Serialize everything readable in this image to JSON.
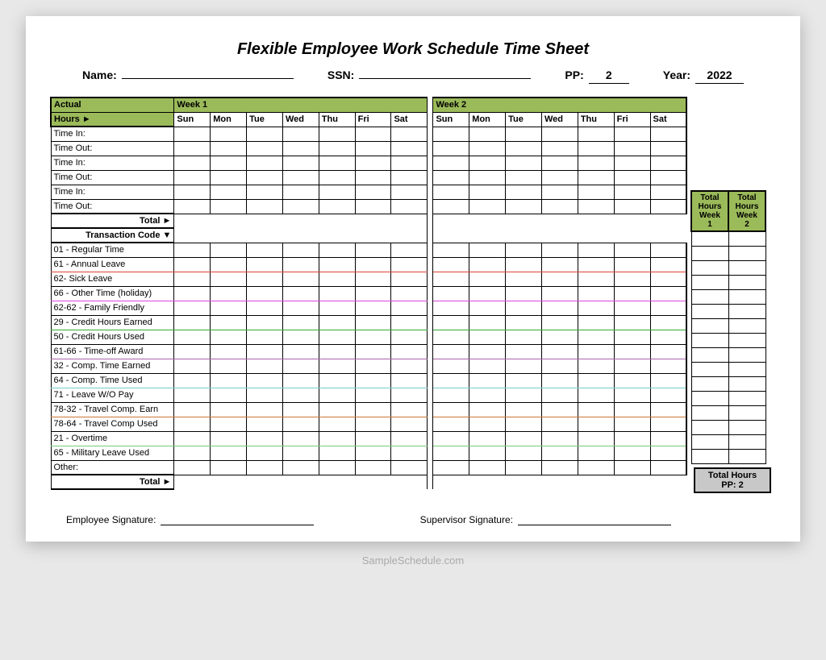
{
  "title": "Flexible Employee Work Schedule Time Sheet",
  "meta": {
    "name_label": "Name:",
    "name_value": "",
    "ssn_label": "SSN:",
    "ssn_value": "",
    "pp_label": "PP:",
    "pp_value": "2",
    "year_label": "Year:",
    "year_value": "2022"
  },
  "headers": {
    "actual_line1": "Actual",
    "actual_line2": "Hours ►",
    "week1": "Week 1",
    "week2": "Week 2",
    "days": [
      "Sun",
      "Mon",
      "Tue",
      "Wed",
      "Thu",
      "Fri",
      "Sat"
    ]
  },
  "time_rows": [
    "Time In:",
    "Time Out:",
    "Time In:",
    "Time Out:",
    "Time In:",
    "Time Out:"
  ],
  "total_label": "Total ►",
  "trans_header": "Transaction Code ▼",
  "trans_rows": [
    {
      "label": "01 - Regular Time",
      "cls": ""
    },
    {
      "label": "61 - Annual Leave",
      "cls": "u-red"
    },
    {
      "label": "62- Sick Leave",
      "cls": ""
    },
    {
      "label": "66 - Other Time (holiday)",
      "cls": "u-mag"
    },
    {
      "label": "62-62 - Family Friendly",
      "cls": ""
    },
    {
      "label": "29 - Credit Hours Earned",
      "cls": "u-grn"
    },
    {
      "label": "50 - Credit Hours Used",
      "cls": ""
    },
    {
      "label": "61-66 - Time-off Award",
      "cls": "u-pur"
    },
    {
      "label": "32 - Comp. Time Earned",
      "cls": ""
    },
    {
      "label": "64 - Comp. Time Used",
      "cls": "u-cyn"
    },
    {
      "label": "71 - Leave W/O Pay",
      "cls": ""
    },
    {
      "label": "78-32 - Travel Comp. Earn",
      "cls": "u-org"
    },
    {
      "label": "78-64 - Travel Comp Used",
      "cls": ""
    },
    {
      "label": "21 - Overtime",
      "cls": "u-lgr"
    },
    {
      "label": "65 - Military Leave Used",
      "cls": ""
    },
    {
      "label": "Other:",
      "cls": ""
    }
  ],
  "totals_side": {
    "h1": "Total Hours Week 1",
    "h2": "Total Hours Week 2"
  },
  "grand_total": {
    "line1": "Total Hours",
    "line2": "PP: 2"
  },
  "signatures": {
    "emp": "Employee Signature:",
    "sup": "Supervisor Signature:"
  },
  "watermark": "SampleSchedule.com"
}
